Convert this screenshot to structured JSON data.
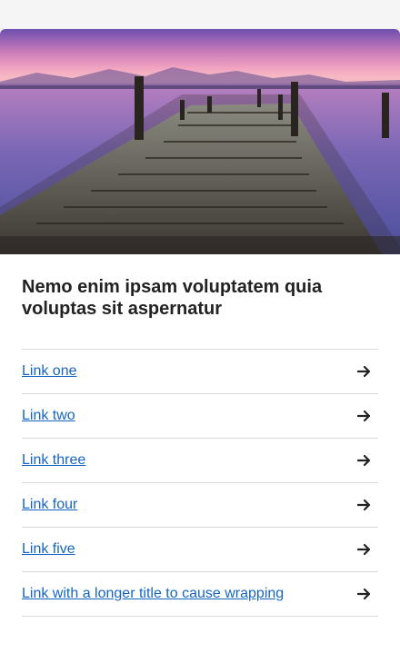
{
  "card": {
    "title": "Nemo enim ipsam voluptatem quia voluptas sit aspernatur",
    "image_alt": "pier-at-sunset-image",
    "links": [
      {
        "label": "Link one",
        "icon": "arrow-right-icon"
      },
      {
        "label": "Link two",
        "icon": "arrow-right-icon"
      },
      {
        "label": "Link three",
        "icon": "arrow-right-icon"
      },
      {
        "label": "Link four",
        "icon": "arrow-right-icon"
      },
      {
        "label": "Link five",
        "icon": "arrow-right-icon"
      },
      {
        "label": "Link with a longer title to cause wrapping",
        "icon": "arrow-right-icon"
      }
    ]
  },
  "colors": {
    "link": "#1565c0",
    "title": "#222222",
    "divider": "#d9d9d9",
    "arrow": "#222222"
  }
}
